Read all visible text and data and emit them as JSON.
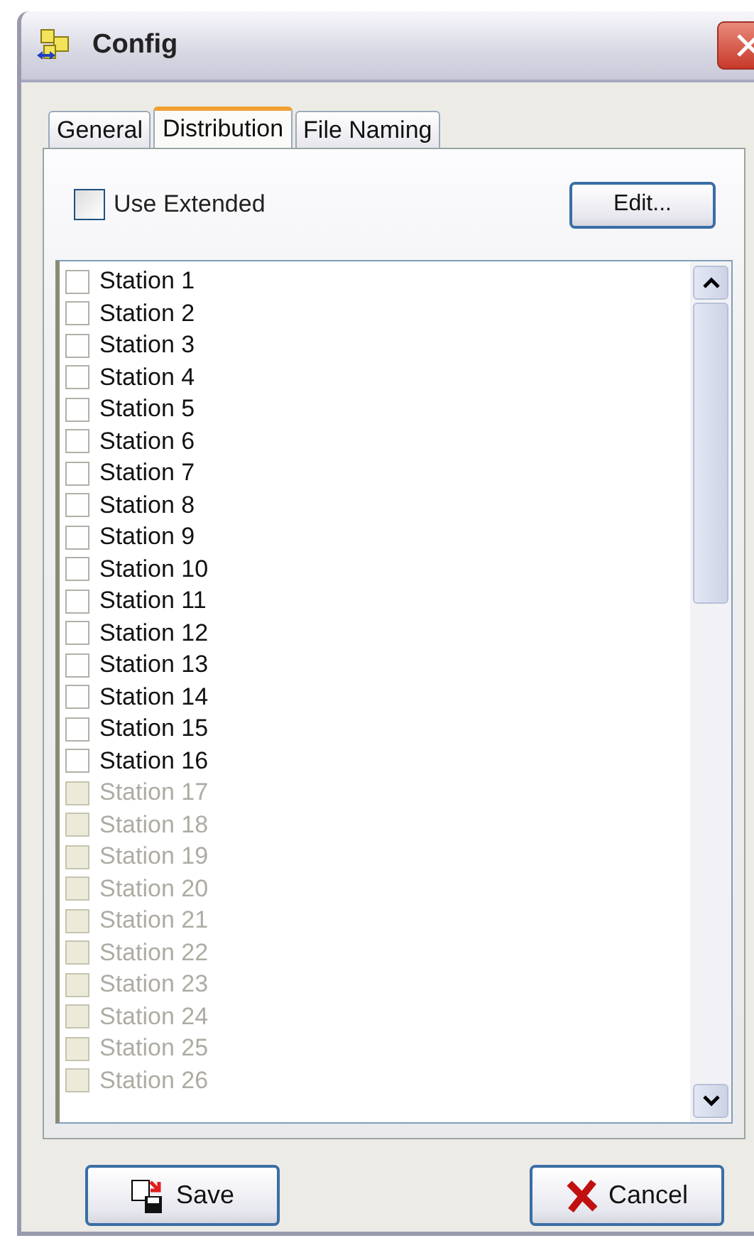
{
  "window": {
    "title": "Config"
  },
  "tabs": [
    {
      "label": "General",
      "selected": false
    },
    {
      "label": "Distribution",
      "selected": true
    },
    {
      "label": "File Naming",
      "selected": false
    }
  ],
  "use_extended": {
    "label": "Use Extended",
    "checked": false
  },
  "edit_button": "Edit...",
  "stations": [
    {
      "label": "Station 1",
      "checked": false,
      "disabled": false
    },
    {
      "label": "Station 2",
      "checked": false,
      "disabled": false
    },
    {
      "label": "Station 3",
      "checked": false,
      "disabled": false
    },
    {
      "label": "Station 4",
      "checked": false,
      "disabled": false
    },
    {
      "label": "Station 5",
      "checked": false,
      "disabled": false
    },
    {
      "label": "Station 6",
      "checked": false,
      "disabled": false
    },
    {
      "label": "Station 7",
      "checked": false,
      "disabled": false
    },
    {
      "label": "Station 8",
      "checked": false,
      "disabled": false
    },
    {
      "label": "Station 9",
      "checked": false,
      "disabled": false
    },
    {
      "label": "Station 10",
      "checked": false,
      "disabled": false
    },
    {
      "label": "Station 11",
      "checked": false,
      "disabled": false
    },
    {
      "label": "Station 12",
      "checked": false,
      "disabled": false
    },
    {
      "label": "Station 13",
      "checked": false,
      "disabled": false
    },
    {
      "label": "Station 14",
      "checked": false,
      "disabled": false
    },
    {
      "label": "Station 15",
      "checked": false,
      "disabled": false
    },
    {
      "label": "Station 16",
      "checked": false,
      "disabled": false
    },
    {
      "label": "Station 17",
      "checked": false,
      "disabled": true
    },
    {
      "label": "Station 18",
      "checked": false,
      "disabled": true
    },
    {
      "label": "Station 19",
      "checked": false,
      "disabled": true
    },
    {
      "label": "Station 20",
      "checked": false,
      "disabled": true
    },
    {
      "label": "Station 21",
      "checked": false,
      "disabled": true
    },
    {
      "label": "Station 22",
      "checked": false,
      "disabled": true
    },
    {
      "label": "Station 23",
      "checked": false,
      "disabled": true
    },
    {
      "label": "Station 24",
      "checked": false,
      "disabled": true
    },
    {
      "label": "Station 25",
      "checked": false,
      "disabled": true
    },
    {
      "label": "Station 26",
      "checked": false,
      "disabled": true
    }
  ],
  "buttons": [
    {
      "label": "Save",
      "kind": "save"
    },
    {
      "label": "Cancel",
      "kind": "cancel"
    }
  ]
}
